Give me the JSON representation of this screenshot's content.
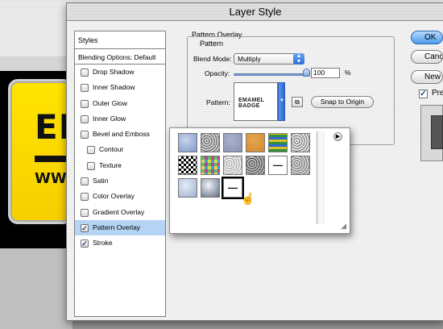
{
  "dialog": {
    "title": "Layer Style"
  },
  "background_logo": {
    "text": "EM",
    "url_fragment": "WW"
  },
  "styles_list": {
    "header": "Styles",
    "blending_options": "Blending Options: Default",
    "items": [
      {
        "label": "Drop Shadow",
        "checked": false,
        "indent": false,
        "selected": false
      },
      {
        "label": "Inner Shadow",
        "checked": false,
        "indent": false,
        "selected": false
      },
      {
        "label": "Outer Glow",
        "checked": false,
        "indent": false,
        "selected": false
      },
      {
        "label": "Inner Glow",
        "checked": false,
        "indent": false,
        "selected": false
      },
      {
        "label": "Bevel and Emboss",
        "checked": false,
        "indent": false,
        "selected": false
      },
      {
        "label": "Contour",
        "checked": false,
        "indent": true,
        "selected": false
      },
      {
        "label": "Texture",
        "checked": false,
        "indent": true,
        "selected": false
      },
      {
        "label": "Satin",
        "checked": false,
        "indent": false,
        "selected": false
      },
      {
        "label": "Color Overlay",
        "checked": false,
        "indent": false,
        "selected": false
      },
      {
        "label": "Gradient Overlay",
        "checked": false,
        "indent": false,
        "selected": false
      },
      {
        "label": "Pattern Overlay",
        "checked": true,
        "indent": false,
        "selected": true
      },
      {
        "label": "Stroke",
        "checked": true,
        "indent": false,
        "selected": false
      }
    ]
  },
  "pattern_overlay": {
    "title": "Pattern Overlay",
    "group_title": "Pattern",
    "blend_mode_label": "Blend Mode:",
    "blend_mode_value": "Multiply",
    "opacity_label": "Opacity:",
    "opacity_value": "100",
    "opacity_unit": "%",
    "pattern_label": "Pattern:",
    "pattern_preview_text": "EMAMEL BADGE",
    "snap_button": "Snap to Origin"
  },
  "pattern_picker": {
    "swatches": [
      {
        "name": "bubbles",
        "colors": [
          "#7f97c9",
          "#c8d4ee"
        ]
      },
      {
        "name": "wrinkles",
        "colors": [
          "#5a5a5a",
          "#d0d0d0"
        ]
      },
      {
        "name": "blue-denim",
        "colors": [
          "#8892b5",
          "#a9b1cc"
        ]
      },
      {
        "name": "orange-burlap",
        "colors": [
          "#d08a2a",
          "#e6a650"
        ]
      },
      {
        "name": "rainbow-stripes",
        "colors": [
          "#2f8f3f",
          "#e0c020"
        ]
      },
      {
        "name": "grayscale-paper",
        "colors": [
          "#6a6a6a",
          "#e8e8e8"
        ]
      },
      {
        "name": "checkerboard",
        "colors": [
          "#000000",
          "#ffffff"
        ]
      },
      {
        "name": "colored-mosaic",
        "colors": [
          "#c53d8f",
          "#3fa2d6"
        ]
      },
      {
        "name": "noise-light",
        "colors": [
          "#9a9a9a",
          "#f0f0f0"
        ]
      },
      {
        "name": "noise-dark",
        "colors": [
          "#3a3a3a",
          "#bdbdbd"
        ]
      },
      {
        "name": "text-badge",
        "colors": [
          "#111111",
          "#ffffff"
        ]
      },
      {
        "name": "fibers",
        "colors": [
          "#6e6e6e",
          "#d5d5d5"
        ]
      },
      {
        "name": "marble-blue",
        "colors": [
          "#9fb0cf",
          "#e3ebf7"
        ]
      },
      {
        "name": "chrome-circle",
        "colors": [
          "#5f6b80",
          "#f2f5fa"
        ]
      },
      {
        "name": "badge-selected",
        "colors": [
          "#000000",
          "#ffffff"
        ]
      }
    ],
    "selected_index": 14
  },
  "right_buttons": {
    "ok": "OK",
    "cancel": "Cancel",
    "new_style": "New Style...",
    "preview_label": "Preview",
    "preview_checked": true
  }
}
